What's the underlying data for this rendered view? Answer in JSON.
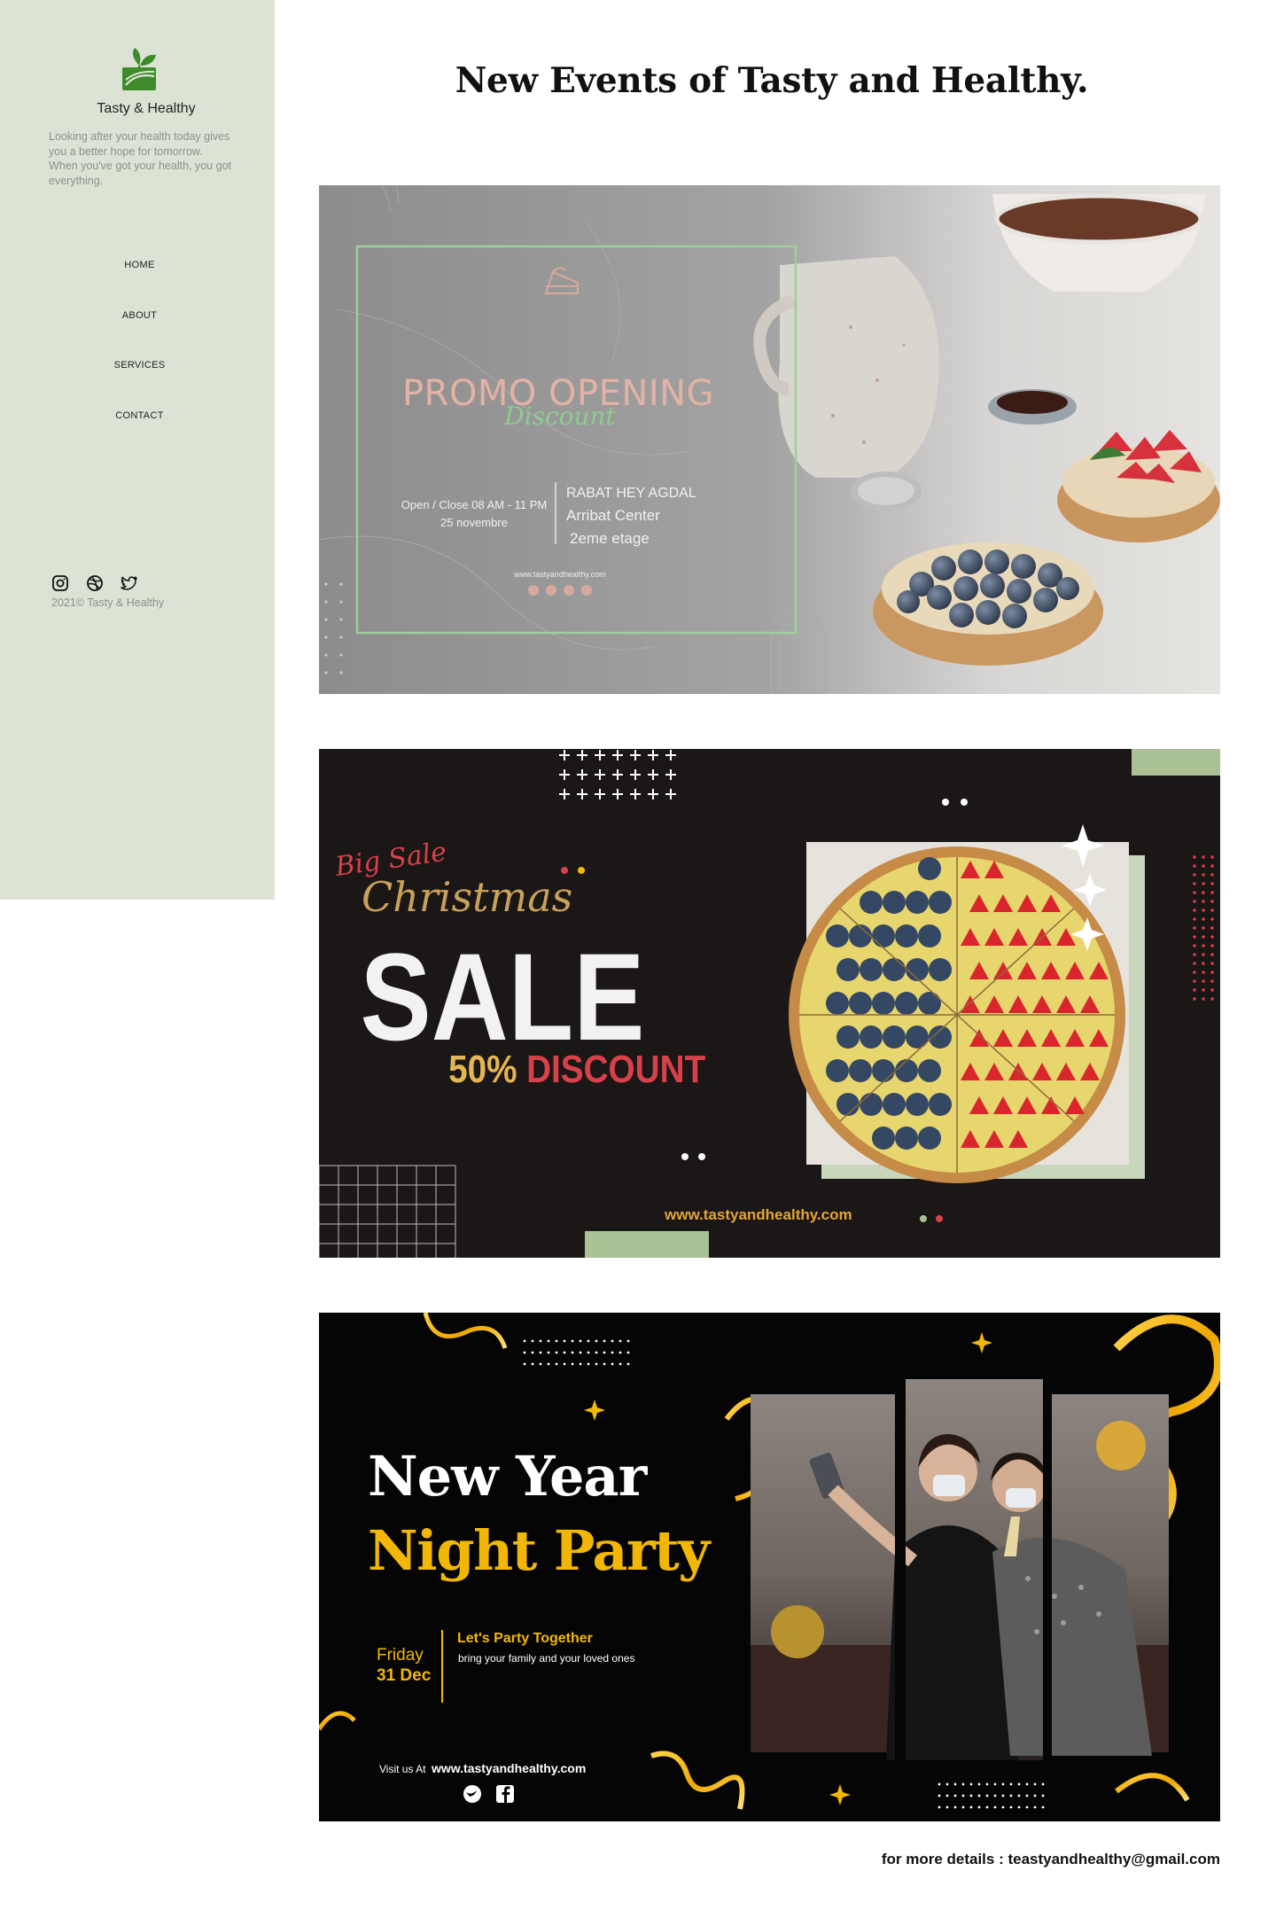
{
  "sidebar": {
    "brand": "Tasty & Healthy",
    "tagline": "Looking after your health today gives you a better hope for tomorrow.\nWhen you've got your health, you got everything.",
    "nav": [
      {
        "label": "HOME"
      },
      {
        "label": "ABOUT"
      },
      {
        "label": "SERVICES"
      },
      {
        "label": "CONTACT"
      }
    ],
    "social_icons": [
      "instagram-icon",
      "dribbble-icon",
      "twitter-icon"
    ],
    "copyright": "2021© Tasty & Healthy"
  },
  "main": {
    "title": "New Events of Tasty and Healthy.",
    "footer_note": "for more details : teastyandhealthy@gmail.com"
  },
  "banners": {
    "promo": {
      "headline": "PROMO OPENING",
      "script": "Discount",
      "hours": "Open / Close 08 AM - 11 PM",
      "date": "25 novembre",
      "address_1": "RABAT HEY AGDAL",
      "address_2": "Arribat Center",
      "address_3": "2eme etage",
      "website": "www.tastyandhealthy.com"
    },
    "christmas": {
      "script_1": "Big Sale",
      "script_2": "Christmas",
      "headline": "SALE",
      "discount_value": "50%",
      "discount_word": "DISCOUNT",
      "website": "www.tastyandhealthy.com"
    },
    "newyear": {
      "headline_1": "New Year",
      "headline_2": "Night Party",
      "day": "Friday",
      "date": "31 Dec",
      "subhead": "Let's Party Together",
      "subtext": "bring your family and your loved ones",
      "visit_prefix": "Visit us At",
      "website": "www.tastyandhealthy.com"
    }
  },
  "colors": {
    "sidebar_bg": "#dce3d5",
    "sage": "#a9c195",
    "gold": "#f2b705",
    "rose": "#d7a89c",
    "red": "#d8404a"
  }
}
